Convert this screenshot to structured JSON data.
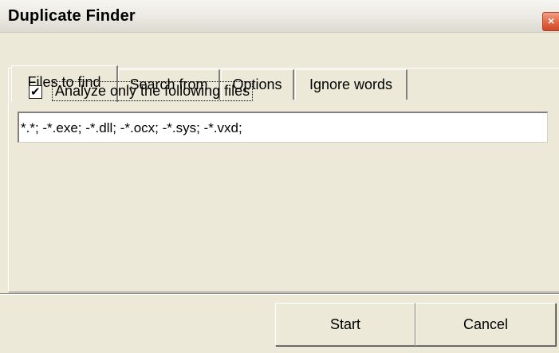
{
  "window": {
    "title": "Duplicate Finder",
    "close_glyph": "×"
  },
  "tabs": [
    {
      "label": "Files to find",
      "active": true
    },
    {
      "label": "Search from",
      "active": false
    },
    {
      "label": "Options",
      "active": false
    },
    {
      "label": "Ignore words",
      "active": false
    }
  ],
  "files_tab": {
    "analyze_checkbox": {
      "label": "Analyze only the following files",
      "checked": true,
      "check_glyph": "✔"
    },
    "file_mask": {
      "value": "*.*; -*.exe; -*.dll; -*.ocx; -*.sys; -*.vxd;"
    }
  },
  "buttons": {
    "start": "Start",
    "cancel": "Cancel"
  },
  "colors": {
    "face": "#ece9d8",
    "close_button": "#e06240",
    "shadow": "#808080",
    "highlight": "#ffffff"
  },
  "icons": {
    "close": "close-icon",
    "check": "checkmark-icon"
  }
}
